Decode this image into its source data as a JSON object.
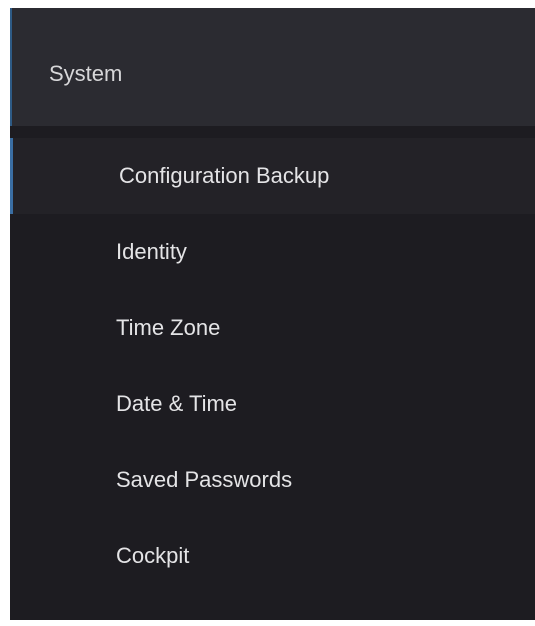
{
  "sidebar": {
    "section": {
      "label": "System"
    },
    "items": [
      {
        "label": "Configuration Backup",
        "active": true
      },
      {
        "label": "Identity",
        "active": false
      },
      {
        "label": "Time Zone",
        "active": false
      },
      {
        "label": "Date & Time",
        "active": false
      },
      {
        "label": "Saved Passwords",
        "active": false
      },
      {
        "label": "Cockpit",
        "active": false
      }
    ]
  },
  "colors": {
    "panel_background": "#1d1c21",
    "section_background": "#2b2b31",
    "active_item_background": "#232227",
    "active_accent": "#3a6ea3",
    "text": "#e4e4e6"
  }
}
